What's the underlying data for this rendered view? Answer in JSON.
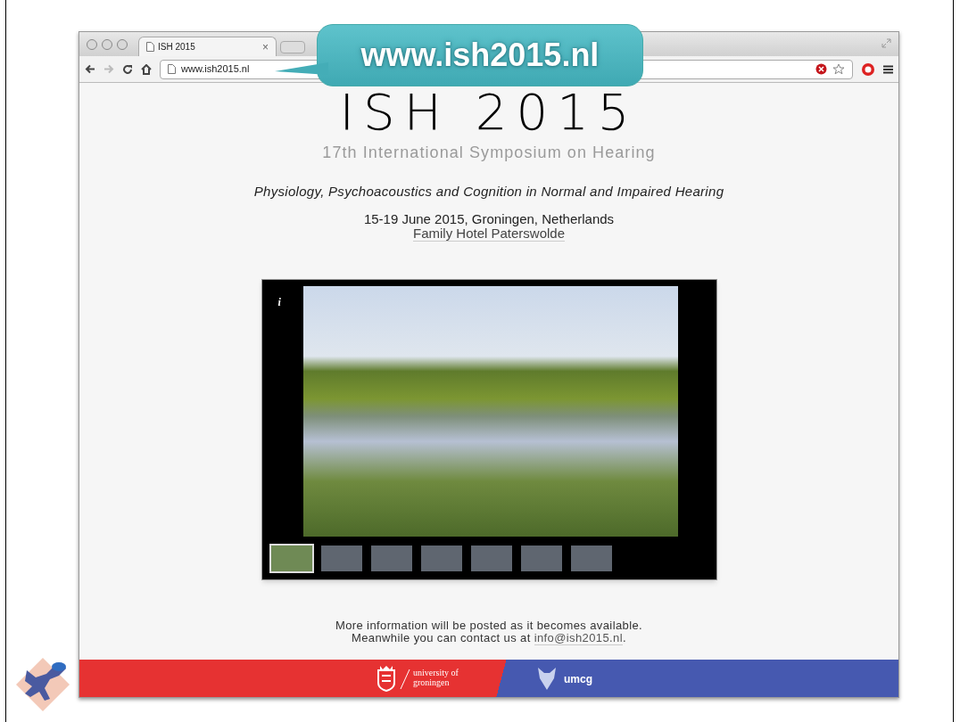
{
  "callout": {
    "text": "www.ish2015.nl"
  },
  "browser": {
    "tab": {
      "title": "ISH 2015",
      "close": "×"
    },
    "address": "www.ish2015.nl"
  },
  "page": {
    "title": "ISH 2015",
    "subtitle": "17th International Symposium on Hearing",
    "tagline": "Physiology, Psychoacoustics and Cognition in Normal and Impaired Hearing",
    "dates": "15-19 June 2015, Groningen, Netherlands",
    "venue_link": "Family Hotel Paterswolde",
    "slideshow": {
      "info": "i",
      "thumbnails": [
        {
          "selected": true
        },
        {
          "selected": false
        },
        {
          "selected": false
        },
        {
          "selected": false
        },
        {
          "selected": false
        },
        {
          "selected": false
        },
        {
          "selected": false
        }
      ]
    },
    "notice_line_1": "More information will be posted as it becomes available.",
    "notice_line_2_prefix": "Meanwhile you can contact us at ",
    "email_link": "info@ish2015.nl",
    "notice_line_2_suffix": ".",
    "footer": {
      "left_logo_text": [
        "university of",
        "groningen"
      ],
      "right_logo_text": "umcg"
    }
  }
}
